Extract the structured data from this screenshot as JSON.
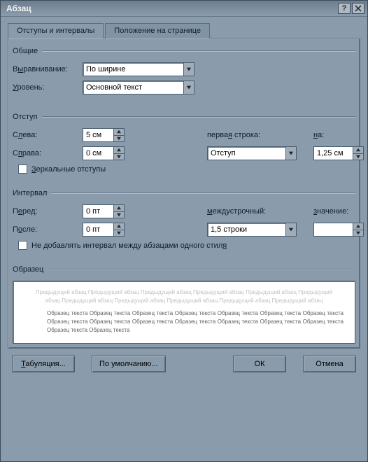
{
  "title": "Абзац",
  "tabs": {
    "active": "Отступы и интервалы",
    "inactive": "Положение на странице"
  },
  "general": {
    "legend": "Общие",
    "alignment_label_pre": "В",
    "alignment_label_u": "ы",
    "alignment_label_post": "равнивание:",
    "alignment_value": "По ширине",
    "level_label_pre": "",
    "level_label_u": "У",
    "level_label_post": "ровень:",
    "level_value": "Основной текст"
  },
  "indent": {
    "legend": "Отступ",
    "left_label_pre": "С",
    "left_label_u": "л",
    "left_label_post": "ева:",
    "left_value": "5 см",
    "right_label_pre": "С",
    "right_label_u": "п",
    "right_label_post": "рава:",
    "right_value": "0 см",
    "first_line_pre": "перва",
    "first_line_u": "я",
    "first_line_post": " строка:",
    "first_line_value": "Отступ",
    "by_label_pre": "",
    "by_label_u": "н",
    "by_label_post": "а:",
    "by_value": "1,25 см",
    "mirror_pre": "",
    "mirror_u": "З",
    "mirror_post": "еркальные отступы"
  },
  "spacing": {
    "legend": "Интервал",
    "before_label_pre": "П",
    "before_label_u": "е",
    "before_label_post": "ред:",
    "before_value": "0 пт",
    "after_label_pre": "П",
    "after_label_u": "о",
    "after_label_post": "сле:",
    "after_value": "0 пт",
    "line_label_pre": "",
    "line_label_u": "м",
    "line_label_post": "еждустрочный:",
    "line_value": "1,5 строки",
    "at_label_pre": "",
    "at_label_u": "з",
    "at_label_post": "начение:",
    "at_value": "",
    "nospace_pre": "Не добавлять интервал между абзацами одного стил",
    "nospace_u": "я",
    "nospace_post": ""
  },
  "preview": {
    "legend": "Образец",
    "gray": "Предыдущий абзац Предыдущий абзац Предыдущий абзац Предыдущий абзац Предыдущий абзац Предыдущий абзац Предыдущий абзац Предыдущий абзац Предыдущий абзац Предыдущий абзац Предыдущий абзац",
    "sample": "Образец текста Образец текста Образец текста Образец текста Образец текста Образец текста Образец текста Образец текста Образец текста Образец текста Образец текста Образец текста Образец текста Образец текста Образец текста Образец текста"
  },
  "buttons": {
    "tabs": "Табуляция...",
    "defaults": "По умолчанию...",
    "ok": "ОК",
    "cancel": "Отмена"
  }
}
